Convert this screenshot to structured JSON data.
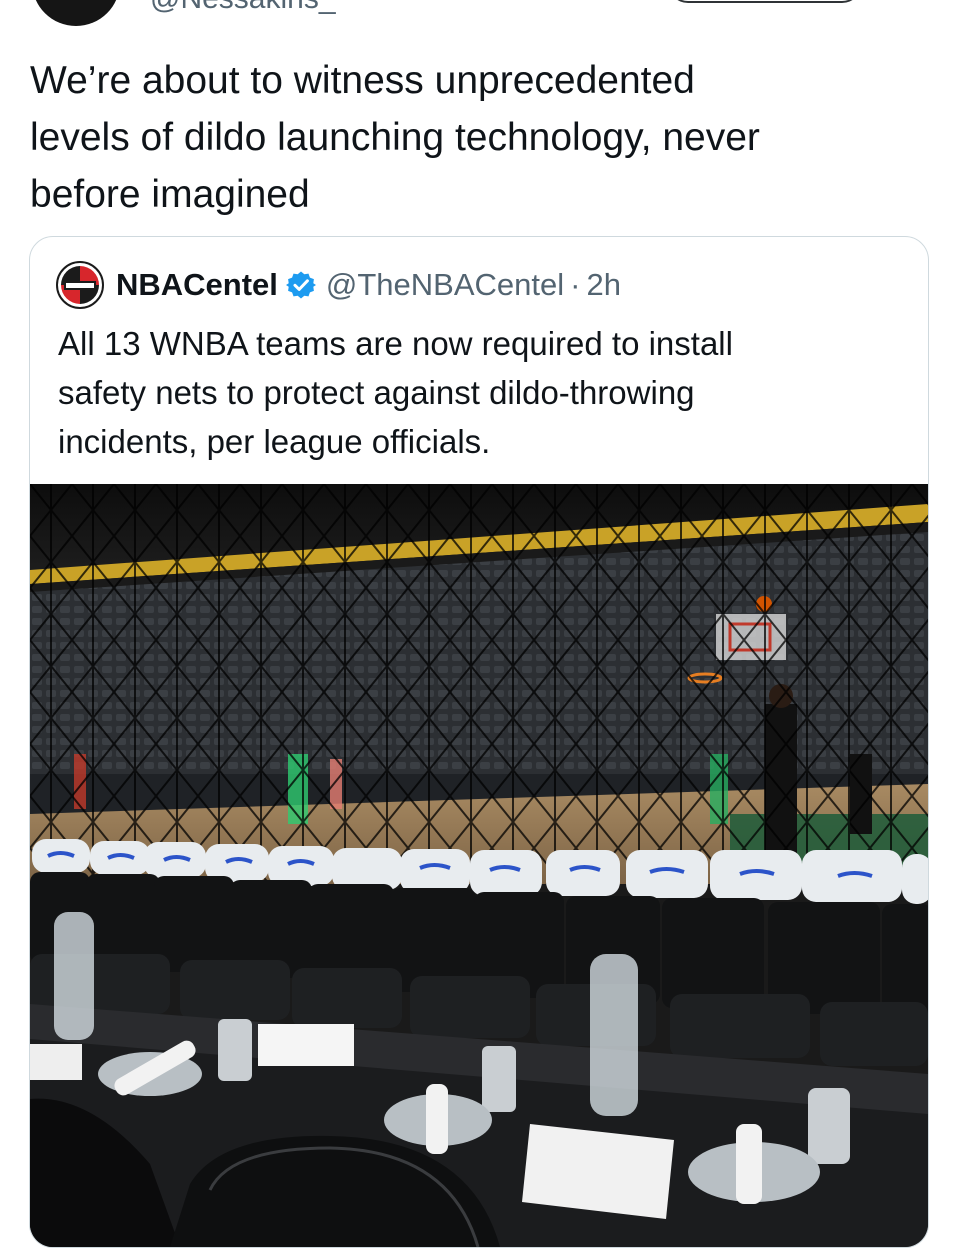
{
  "author": {
    "handle": "@Nessakins_"
  },
  "tweet": {
    "text": "We’re about to witness unprecedented\nlevels of dildo launching technology, never\nbefore imagined"
  },
  "quote": {
    "name": "NBACentel",
    "handle": "@TheNBACentel",
    "separator": "·",
    "time": "2h",
    "text": "All 13 WNBA teams are now required to install\nsafety nets to protect against dildo-throwing\nincidents, per league officials.",
    "avatar_icon": "nba-centel-logo-icon",
    "verified_icon": "verified-badge-icon",
    "verified_color": "#1d9bf0"
  },
  "photo": {
    "subject": "arena-courtside-with-safety-net"
  }
}
